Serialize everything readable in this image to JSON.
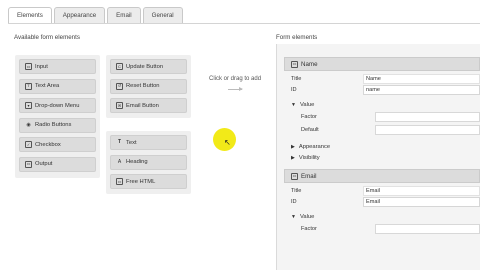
{
  "tabs": [
    {
      "label": "Elements",
      "active": true
    },
    {
      "label": "Appearance",
      "active": false
    },
    {
      "label": "Email",
      "active": false
    },
    {
      "label": "General",
      "active": false
    }
  ],
  "available": {
    "title": "Available form elements",
    "col1": [
      {
        "label": "Input",
        "icon": "input-icon",
        "glyph": "▭"
      },
      {
        "label": "Text Area",
        "icon": "textarea-icon",
        "glyph": "T"
      },
      {
        "label": "Drop-down Menu",
        "icon": "dropdown-icon",
        "glyph": "▾"
      },
      {
        "label": "Radio Buttons",
        "icon": "radio-icon",
        "glyph": "◉"
      },
      {
        "label": "Checkbox",
        "icon": "checkbox-icon",
        "glyph": "✓"
      },
      {
        "label": "Output",
        "icon": "output-icon",
        "glyph": "▭"
      }
    ],
    "col2": [
      {
        "label": "Update Button",
        "icon": "update-icon",
        "glyph": "C"
      },
      {
        "label": "Reset Button",
        "icon": "reset-icon",
        "glyph": "↺"
      },
      {
        "label": "Email Button",
        "icon": "email-icon",
        "glyph": "✉"
      }
    ],
    "col3": [
      {
        "label": "Text",
        "icon": "text-icon",
        "glyph": "T"
      },
      {
        "label": "Heading",
        "icon": "heading-icon",
        "glyph": "A"
      },
      {
        "label": "Free HTML",
        "icon": "html-icon",
        "glyph": "▭"
      }
    ]
  },
  "hint": "Click or drag to add",
  "form": {
    "title": "Form elements",
    "elements": [
      {
        "header": "Name",
        "title_label": "Title",
        "title_value": "Name",
        "id_label": "ID",
        "id_value": "name",
        "value_section": "Value",
        "factor_label": "Factor",
        "default_label": "Default",
        "appearance_section": "Appearance",
        "visibility_section": "Visibility"
      },
      {
        "header": "Email",
        "title_label": "Title",
        "title_value": "Email",
        "id_label": "ID",
        "id_value": "Email",
        "value_section": "Value",
        "factor_label": "Factor"
      }
    ]
  }
}
